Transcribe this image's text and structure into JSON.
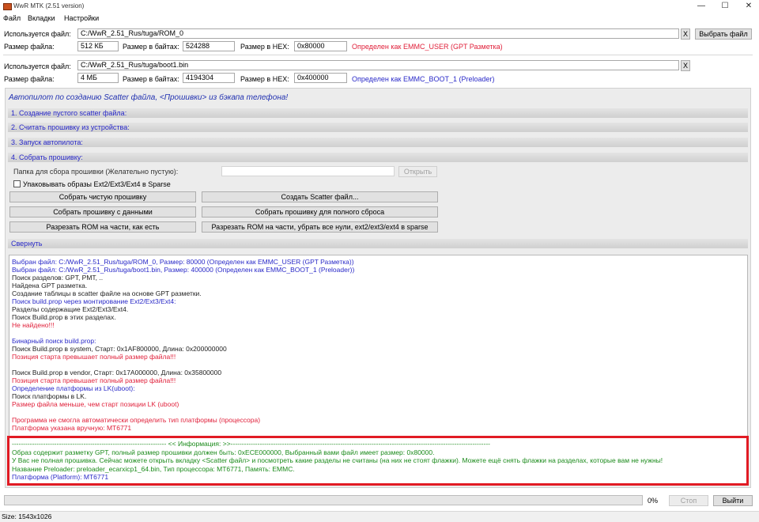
{
  "window": {
    "title": "WwR MTK (2.51 version)",
    "min": "—",
    "max": "☐",
    "close": "✕"
  },
  "menu": [
    "Файл",
    "Вкладки",
    "Настройки"
  ],
  "file1": {
    "label": "Используется файл:",
    "path": "C:/WwR_2.51_Rus/tuga/ROM_0",
    "x": "X",
    "choose": "Выбрать файл",
    "size_label": "Размер файла:",
    "size": "512 КБ",
    "bytes_label": "Размер в байтах:",
    "bytes": "524288",
    "hex_label": "Размер в HEX:",
    "hex": "0x80000",
    "detected": "Определен как EMMC_USER (GPT Разметка)"
  },
  "file2": {
    "label": "Используется файл:",
    "path": "C:/WwR_2.51_Rus/tuga/boot1.bin",
    "x": "X",
    "size_label": "Размер файла:",
    "size": "4 МБ",
    "bytes_label": "Размер в байтах:",
    "bytes": "4194304",
    "hex_label": "Размер в HEX:",
    "hex": "0x400000",
    "detected": "Определен как EMMC_BOOT_1 (Preloader)"
  },
  "autopilot": {
    "heading": "Автопилот по созданию Scatter файла, <Прошивки> из бэкапа телефона!",
    "sections": [
      "1. Создание пустого scatter файла:",
      "2. Считать прошивку из устройства:",
      "3. Запуск автопилота:",
      "4. Собрать прошивку:"
    ],
    "folder_label": "Папка для сбора прошивки (Желательно пустую):",
    "folder_value": "",
    "open_btn": "Открыть",
    "sparse_label": "Упаковывать образы Ext2/Ext3/Ext4 в Sparse",
    "buttons": {
      "clean": "Собрать чистую прошивку",
      "scatter": "Создать Scatter файл...",
      "with_data": "Собрать прошивку с данными",
      "full_reset": "Собрать прошивку для полного сброса",
      "split_asis": "Разрезать ROM на части, как есть",
      "split_sparse": "Разрезать ROM на части, убрать все нули, ext2/ext3/ext4 в sparse"
    },
    "collapse": "Свернуть"
  },
  "log": [
    {
      "c": "blue",
      "t": "Выбран файл: C:/WwR_2.51_Rus/tuga/ROM_0, Размер: 80000 (Определен как EMMC_USER (GPT Разметка))"
    },
    {
      "c": "blue",
      "t": "Выбран файл: C:/WwR_2.51_Rus/tuga/boot1.bin, Размер: 400000 (Определен как EMMC_BOOT_1 (Preloader))"
    },
    {
      "c": "black",
      "t": "Поиск разделов: GPT, PMT, .."
    },
    {
      "c": "black",
      "t": "Найдена GPT разметка."
    },
    {
      "c": "black",
      "t": "Создание таблицы в scatter файле на основе GPT разметки."
    },
    {
      "c": "blue",
      "t": "Поиск build.prop через монтирование Ext2/Ext3/Ext4:"
    },
    {
      "c": "black",
      "t": "Разделы содержащие Ext2/Ext3/Ext4."
    },
    {
      "c": "black",
      "t": "Поиск Build.prop в этих разделах."
    },
    {
      "c": "red",
      "t": "Не найдено!!!"
    },
    {
      "c": "black",
      "t": ""
    },
    {
      "c": "blue",
      "t": "Бинарный поиск build.prop:"
    },
    {
      "c": "black",
      "t": "Поиск Build.prop в system, Старт: 0x1AF800000, Длина: 0x200000000"
    },
    {
      "c": "red",
      "t": "Позиция старта превышает полный размер файла!!!"
    },
    {
      "c": "black",
      "t": ""
    },
    {
      "c": "black",
      "t": "Поиск Build.prop в vendor, Старт: 0x17A000000, Длина: 0x35800000"
    },
    {
      "c": "red",
      "t": "Позиция старта превышает полный размер файла!!!"
    },
    {
      "c": "blue",
      "t": "Определение платформы из LK(uboot):"
    },
    {
      "c": "black",
      "t": "Поиск платформы в LK."
    },
    {
      "c": "red",
      "t": "Размер файла меньше, чем старт позиции LK (uboot)"
    },
    {
      "c": "black",
      "t": ""
    },
    {
      "c": "red",
      "t": "Программа не смогла автоматически определить тип платформы (процессора)"
    },
    {
      "c": "red",
      "t": "Платформа указана вручную: MT6771"
    }
  ],
  "info": [
    {
      "c": "green",
      "t": "--------------------------------------------------------------------- << Информация: >>--------------------------------------------------------------------------------------------------------------------"
    },
    {
      "c": "green",
      "t": "Образ содержит разметку GPT, полный размер прошивки должен быть: 0xECE000000, Выбранный вами файл имеет размер: 0x80000."
    },
    {
      "c": "green",
      "t": "У Вас не полная прошивка.  Сейчас можете открыть вкладку <Scatter файл> и посмотреть какие разделы не считаны (на них не стоят флажки).  Можете ещё снять флажки на разделах, которые вам не нужны!"
    },
    {
      "c": "green",
      "t": "Название Preloader: preloader_ecarxicp1_64.bin, Тип процессора: MT6771, Память: EMMC."
    },
    {
      "c": "blue",
      "t": "Платформа (Platform): MT6771"
    }
  ],
  "bottom": {
    "progress": "0%",
    "progress_value": 0,
    "stop": "Стоп",
    "exit": "Выйти"
  },
  "statusbar": "Size:  1543x1026"
}
